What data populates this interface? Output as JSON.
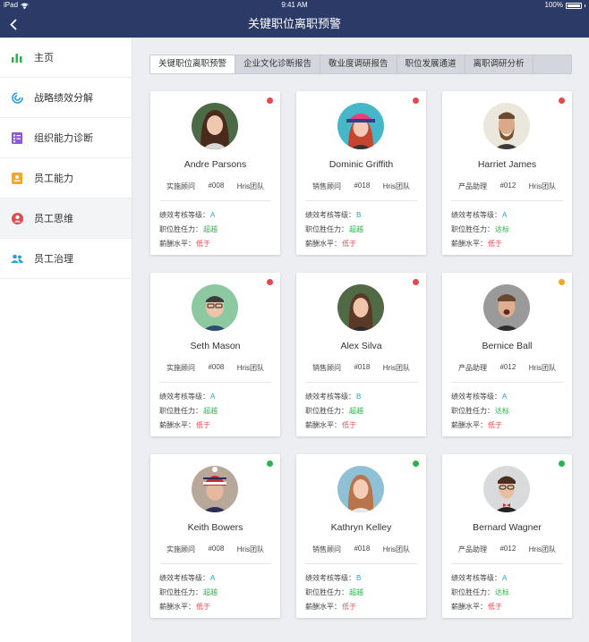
{
  "status": {
    "device": "iPad",
    "time": "9:41 AM",
    "battery": "100%"
  },
  "nav": {
    "title": "关键职位离职预警"
  },
  "sidebar": {
    "items": [
      {
        "label": "主页",
        "icon": "bar-chart-icon",
        "color": "#2bb24c"
      },
      {
        "label": "战略绩效分解",
        "icon": "target-icon",
        "color": "#2a9fd8"
      },
      {
        "label": "组织能力诊断",
        "icon": "list-icon",
        "color": "#8e5ad6"
      },
      {
        "label": "员工能力",
        "icon": "id-card-icon",
        "color": "#f5a623"
      },
      {
        "label": "员工思维",
        "icon": "person-icon",
        "color": "#e5484d"
      },
      {
        "label": "员工治理",
        "icon": "people-icon",
        "color": "#2a9fd8"
      }
    ],
    "active": 4
  },
  "tabs": [
    "关键职位离职预警",
    "企业文化诊断报告",
    "敬业度调研报告",
    "职位发展通道",
    "离职调研分析"
  ],
  "labels": {
    "perf": "绩效考核等级：",
    "fit": "职位胜任力：",
    "salary": "薪酬水平："
  },
  "colors": {
    "red_dot": "#e5484d",
    "yellow_dot": "#f5a623",
    "green_dot": "#2bb24c"
  },
  "cards": [
    {
      "name": "Andre Parsons",
      "role": "实施顾问",
      "code": "#008",
      "team": "Hris团队",
      "perf": "A",
      "fit": "超越",
      "salary": "低于",
      "status": "red"
    },
    {
      "name": "Dominic Griffith",
      "role": "销售顾问",
      "code": "#018",
      "team": "Hris团队",
      "perf": "B",
      "fit": "超越",
      "salary": "低于",
      "status": "red"
    },
    {
      "name": "Harriet James",
      "role": "产品助理",
      "code": "#012",
      "team": "Hris团队",
      "perf": "A",
      "fit": "达标",
      "salary": "低于",
      "status": "red"
    },
    {
      "name": "Seth Mason",
      "role": "实施顾问",
      "code": "#008",
      "team": "Hris团队",
      "perf": "A",
      "fit": "超越",
      "salary": "低于",
      "status": "red"
    },
    {
      "name": "Alex Silva",
      "role": "销售顾问",
      "code": "#018",
      "team": "Hris团队",
      "perf": "B",
      "fit": "超越",
      "salary": "低于",
      "status": "red"
    },
    {
      "name": "Bernice Ball",
      "role": "产品助理",
      "code": "#012",
      "team": "Hris团队",
      "perf": "A",
      "fit": "达标",
      "salary": "低于",
      "status": "yellow"
    },
    {
      "name": "Keith Bowers",
      "role": "实施顾问",
      "code": "#008",
      "team": "Hris团队",
      "perf": "A",
      "fit": "超越",
      "salary": "低于",
      "status": "green"
    },
    {
      "name": "Kathryn Kelley",
      "role": "销售顾问",
      "code": "#018",
      "team": "Hris团队",
      "perf": "B",
      "fit": "超越",
      "salary": "低于",
      "status": "green"
    },
    {
      "name": "Bernard Wagner",
      "role": "产品助理",
      "code": "#012",
      "team": "Hris团队",
      "perf": "A",
      "fit": "达标",
      "salary": "低于",
      "status": "green"
    }
  ]
}
